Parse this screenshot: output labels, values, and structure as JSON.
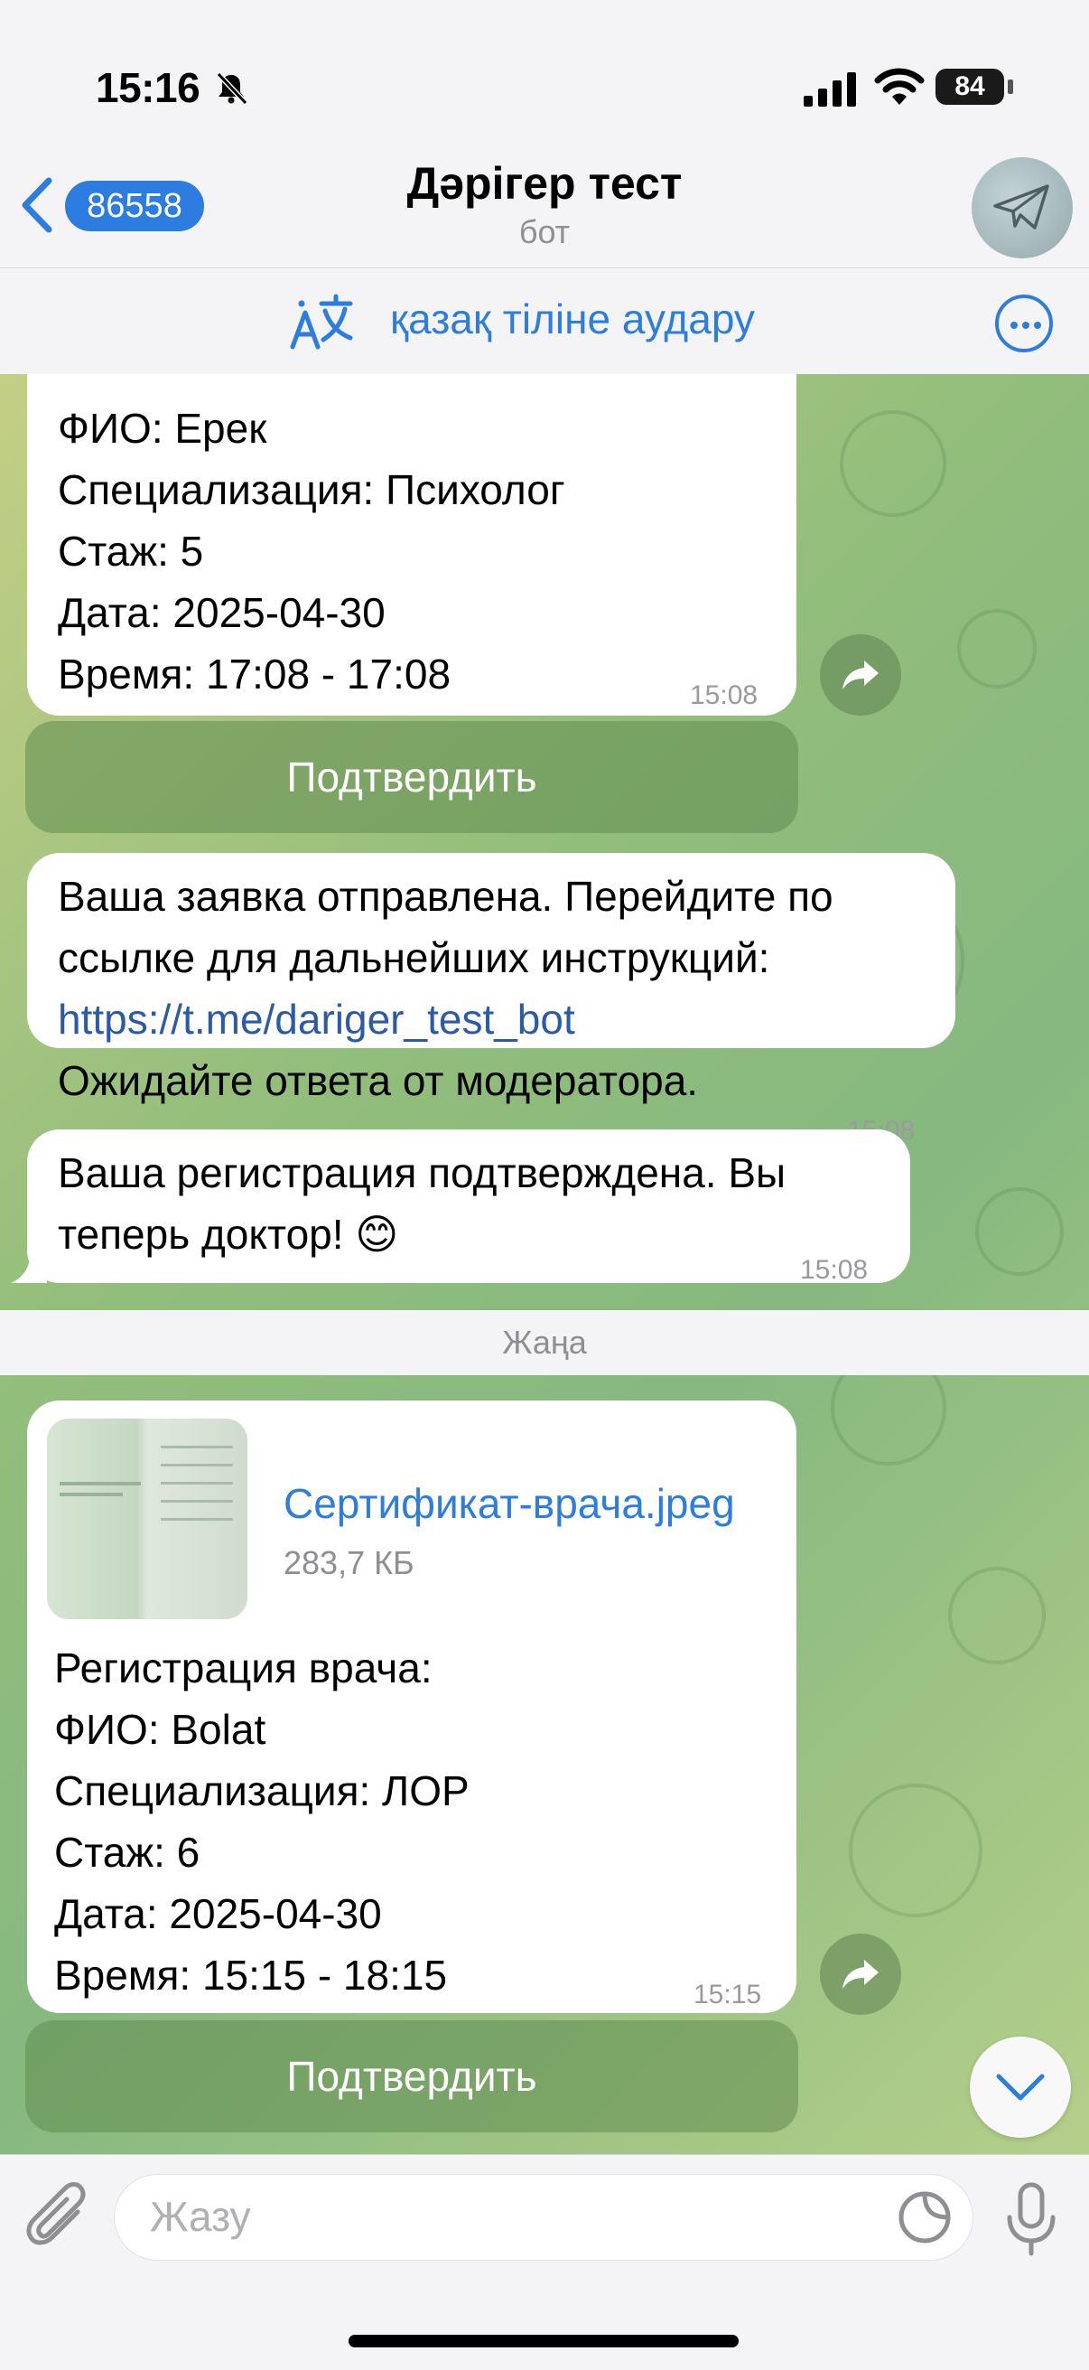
{
  "status_bar": {
    "time": "15:16",
    "battery": "84"
  },
  "header": {
    "back_count": "86558",
    "title": "Дәрігер тест",
    "subtitle": "бот"
  },
  "translate_bar": {
    "label": "қазақ тіліне аудару"
  },
  "messages": {
    "m1": {
      "lines": [
        "ФИО: Ерек",
        "Специализация: Психолог",
        "Стаж: 5",
        "Дата: 2025-04-30",
        "Время: 17:08 - 17:08"
      ],
      "time": "15:08",
      "button": "Подтвердить"
    },
    "m2": {
      "line1": "Ваша заявка отправлена. Перейдите по",
      "line2": "ссылке для дальнейших инструкций:",
      "link": "https://t.me/dariger_test_bot",
      "line4": "Ожидайте ответа от модератора.",
      "time": "15:08"
    },
    "m3": {
      "line1": "Ваша регистрация подтверждена. Вы",
      "line2": "теперь доктор! 😊",
      "time": "15:08"
    },
    "separator": "Жаңа",
    "m4": {
      "file_name": "Сертификат-врача.jpeg",
      "file_size": "283,7 КБ",
      "lines": [
        "Регистрация врача:",
        "ФИО: Bolat",
        "Специализация: ЛОР",
        "Стаж: 6",
        "Дата: 2025-04-30",
        "Время: 15:15 - 18:15"
      ],
      "time": "15:15",
      "button": "Подтвердить"
    }
  },
  "input": {
    "placeholder": "Жазу"
  },
  "colors": {
    "accent": "#2d7de0",
    "bubble": "#ffffff",
    "chat_bg": "#93be7c"
  },
  "icons": [
    "bell-slash-icon",
    "signal-icon",
    "wifi-icon",
    "battery-icon",
    "back-chevron-icon",
    "translate-icon",
    "more-icon",
    "forward-icon",
    "chevron-down-icon",
    "attachment-icon",
    "sticker-icon",
    "microphone-icon"
  ]
}
